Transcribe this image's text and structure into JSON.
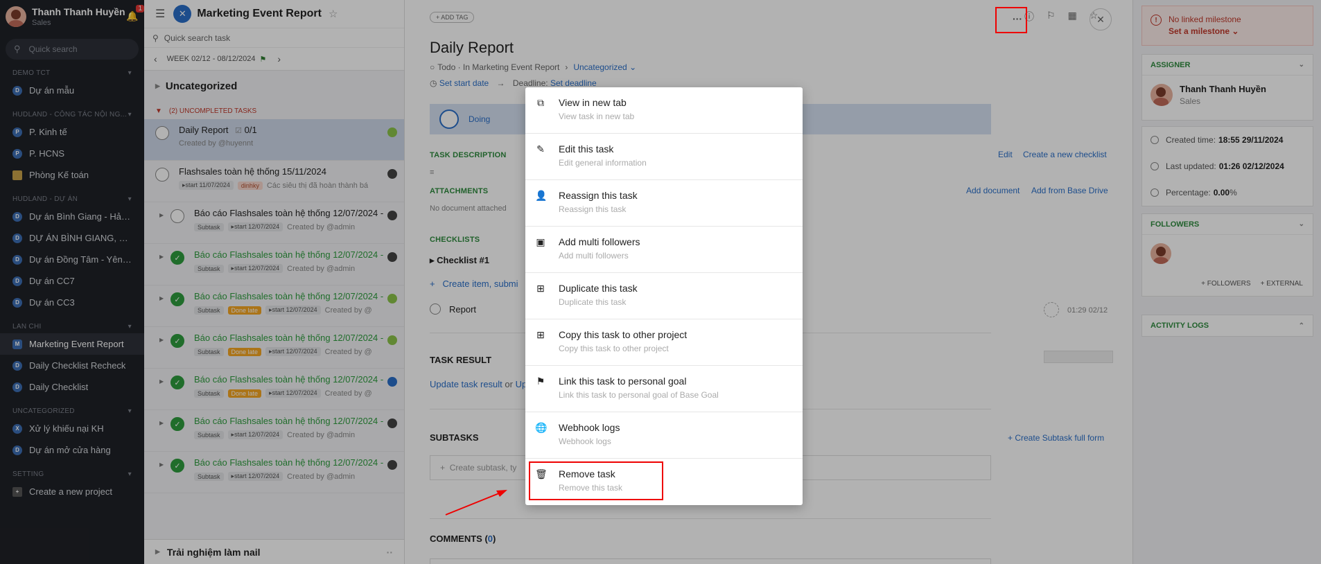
{
  "user": {
    "name": "Thanh Thanh Huyền",
    "role": "Sales",
    "notifications": "1"
  },
  "sidebar": {
    "search_placeholder": "Quick search",
    "groups": [
      {
        "label": "DEMO TCT",
        "items": [
          {
            "icon": "D",
            "label": "Dự án mẫu"
          }
        ]
      },
      {
        "label": "HUDLAND - CÔNG TÁC NỘI NG...",
        "items": [
          {
            "icon": "P",
            "label": "P. Kinh tế"
          },
          {
            "icon": "P",
            "label": "P. HCNS"
          },
          {
            "icon": "folder",
            "label": "Phòng Kế toán"
          }
        ]
      },
      {
        "label": "HUDLAND - DỰ ÁN",
        "items": [
          {
            "icon": "D",
            "label": "Dự án Bình Giang - Hải D..."
          },
          {
            "icon": "D",
            "label": "DỰ ÁN BÌNH GIANG, HẢI ..."
          },
          {
            "icon": "D",
            "label": "Dự án Đồng Tâm - Yên Bái"
          },
          {
            "icon": "D",
            "label": "Dự án CC7"
          },
          {
            "icon": "D",
            "label": "Dự án CC3"
          }
        ]
      },
      {
        "label": "LAN CHI",
        "items": [
          {
            "icon": "M",
            "label": "Marketing Event Report",
            "active": true
          },
          {
            "icon": "D",
            "label": "Daily Checklist Recheck"
          },
          {
            "icon": "D",
            "label": "Daily Checklist"
          }
        ]
      },
      {
        "label": "UNCATEGORIZED",
        "items": [
          {
            "icon": "X",
            "label": "Xử lý khiếu nại KH"
          },
          {
            "icon": "D",
            "label": "Dự án mở cửa hàng"
          }
        ]
      },
      {
        "label": "SETTING",
        "items": [
          {
            "icon": "+",
            "label": "Create a new project"
          }
        ]
      }
    ]
  },
  "tasklist": {
    "project_title": "Marketing Event Report",
    "search_placeholder": "Quick search task",
    "week": "WEEK 02/12 - 08/12/2024",
    "category": "Uncategorized",
    "uncompleted": "(2) UNCOMPLETED TASKS",
    "tasks": [
      {
        "title": "Daily Report",
        "count": "0/1",
        "meta": "Created by @huyennt"
      },
      {
        "title": "Flashsales toàn hệ thống 15/11/2024",
        "tag1": "start 11/07/2024",
        "tag2": "dinhky",
        "meta": "Các siêu thị đã hoàn thành bá"
      }
    ],
    "subtasks": [
      {
        "title": "Báo cáo Flashsales toàn hệ thống 12/07/2024 -",
        "done": false,
        "late": false,
        "start": "start 12/07/2024",
        "meta": "Created by @admin"
      },
      {
        "title": "Báo cáo Flashsales toàn hệ thống 12/07/2024 -",
        "done": true,
        "late": false,
        "start": "start 12/07/2024",
        "meta": "Created by @admin"
      },
      {
        "title": "Báo cáo Flashsales toàn hệ thống 12/07/2024 -",
        "done": true,
        "late": true,
        "start": "start 12/07/2024",
        "meta": "Created by @"
      },
      {
        "title": "Báo cáo Flashsales toàn hệ thống 12/07/2024 -",
        "done": true,
        "late": true,
        "start": "start 12/07/2024",
        "meta": "Created by @"
      },
      {
        "title": "Báo cáo Flashsales toàn hệ thống 12/07/2024 -",
        "done": true,
        "late": true,
        "start": "start 12/07/2024",
        "meta": "Created by @"
      },
      {
        "title": "Báo cáo Flashsales toàn hệ thống 12/07/2024 -",
        "done": true,
        "late": false,
        "start": "start 12/07/2024",
        "meta": "Created by @admin"
      },
      {
        "title": "Báo cáo Flashsales toàn hệ thống 12/07/2024 -",
        "done": true,
        "late": false,
        "start": "start 12/07/2024",
        "meta": "Created by @admin"
      }
    ],
    "subtask_tag": "Subtask",
    "late_tag": "Done late",
    "footer_category": "Trải nghiệm làm nail"
  },
  "detail": {
    "add_tag": "ADD TAG",
    "title": "Daily Report",
    "breadcrumb": "Todo · In Marketing Event Report",
    "category": "Uncategorized",
    "start_date": "Set start date",
    "deadline_label": "Deadline:",
    "deadline": "Set deadline",
    "status": "Doing",
    "task_description": "TASK DESCRIPTION",
    "edit": "Edit",
    "create_checklist": "Create a new checklist",
    "attachments": "ATTACHMENTS",
    "no_document": "No document attached",
    "add_document": "Add document",
    "add_from_drive": "Add from Base Drive",
    "checklists": "CHECKLISTS",
    "checklist_name": "Checklist #1",
    "create_item": "Create item, submi",
    "report_item": "Report",
    "report_time": "01:29 02/12",
    "task_result": "TASK RESULT",
    "update_result": "Update task result",
    "or": "or",
    "up": "Up",
    "subtasks": "SUBTASKS",
    "create_subtask_full": "Create Subtask full form",
    "create_subtask_placeholder": "Create subtask, ty",
    "comments": "COMMENTS",
    "comments_count": "0"
  },
  "right": {
    "milestone": "No linked milestone",
    "set_milestone": "Set a milestone",
    "assigner": "ASSIGNER",
    "assigner_name": "Thanh Thanh Huyền",
    "assigner_role": "Sales",
    "created_label": "Created time:",
    "created": "18:55 29/11/2024",
    "updated_label": "Last updated:",
    "updated": "01:26 02/12/2024",
    "percent_label": "Percentage:",
    "percent": "0.00",
    "percent_unit": "%",
    "followers": "FOLLOWERS",
    "add_followers": "FOLLOWERS",
    "add_external": "EXTERNAL",
    "activity": "ACTIVITY LOGS"
  },
  "menu": [
    {
      "icon": "external-link-icon",
      "label": "View in new tab",
      "sub": "View task in new tab"
    },
    {
      "icon": "pencil-icon",
      "label": "Edit this task",
      "sub": "Edit general information"
    },
    {
      "icon": "person-icon",
      "label": "Reassign this task",
      "sub": "Reassign this task"
    },
    {
      "icon": "contacts-icon",
      "label": "Add multi followers",
      "sub": "Add multi followers"
    },
    {
      "icon": "plus-square-icon",
      "label": "Duplicate this task",
      "sub": "Duplicate this task"
    },
    {
      "icon": "plus-square-icon",
      "label": "Copy this task to other project",
      "sub": "Copy this task to other project"
    },
    {
      "icon": "flag-icon",
      "label": "Link this task to personal goal",
      "sub": "Link this task to personal goal of Base Goal"
    },
    {
      "icon": "globe-icon",
      "label": "Webhook logs",
      "sub": "Webhook logs"
    },
    {
      "icon": "trash-icon",
      "label": "Remove task",
      "sub": "Remove this task"
    }
  ]
}
